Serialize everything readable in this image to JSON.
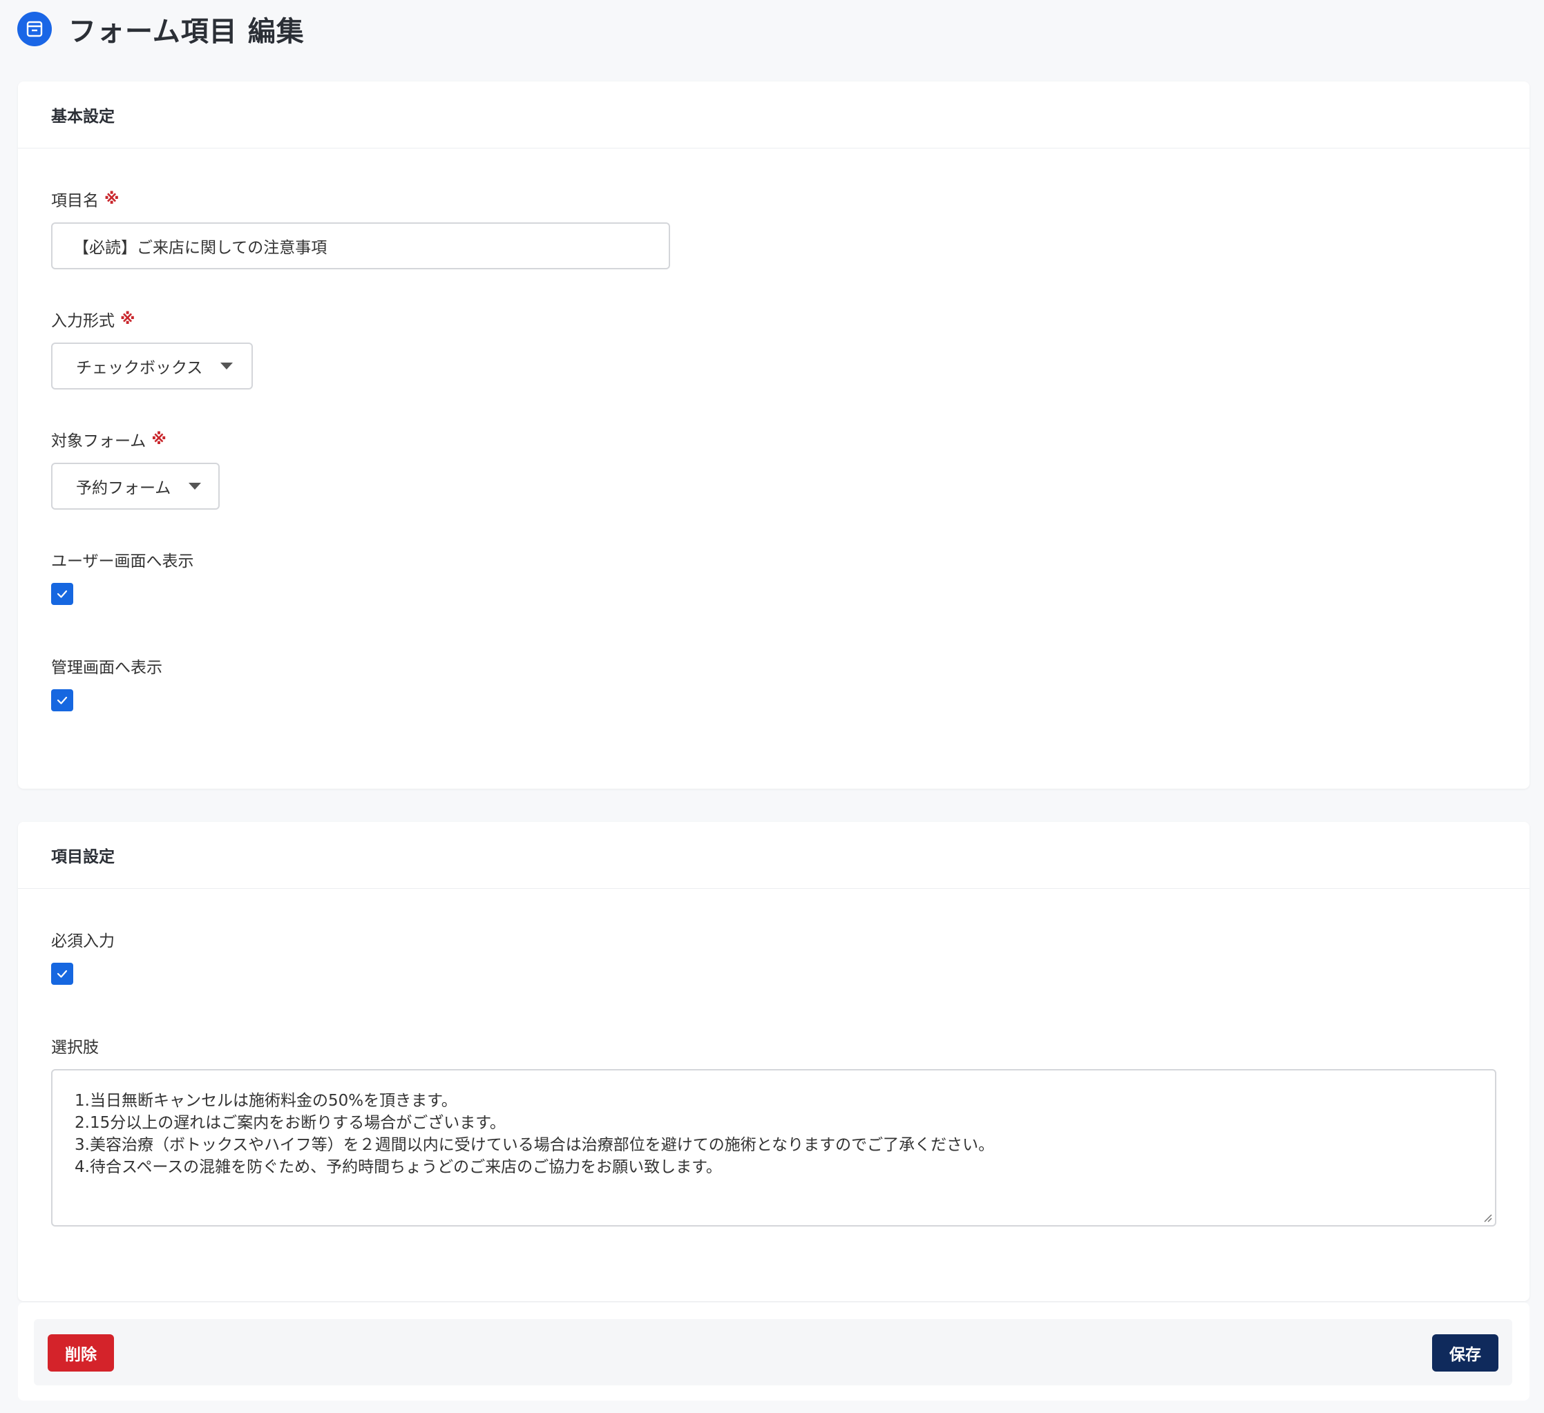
{
  "page": {
    "title": "フォーム項目 編集",
    "icon": "form-icon",
    "accent_color": "#1a66e6"
  },
  "basic_settings": {
    "header": "基本設定",
    "required_mark": "※",
    "item_name": {
      "label": "項目名",
      "value": "【必読】ご来店に関しての注意事項"
    },
    "input_type": {
      "label": "入力形式",
      "selected": "チェックボックス"
    },
    "target_form": {
      "label": "対象フォーム",
      "selected": "予約フォーム"
    },
    "show_user": {
      "label": "ユーザー画面へ表示",
      "checked": true
    },
    "show_admin": {
      "label": "管理画面へ表示",
      "checked": true
    }
  },
  "item_settings": {
    "header": "項目設定",
    "required_input": {
      "label": "必須入力",
      "checked": true
    },
    "choices": {
      "label": "選択肢",
      "lines": [
        "1.当日無断キャンセルは施術料金の50%を頂きます。",
        "2.15分以上の遅れはご案内をお断りする場合がございます。",
        "3.美容治療（ボトックスやハイフ等）を２週間以内に受けている場合は治療部位を避けての施術となりますのでご了承ください。",
        "4.待合スペースの混雑を防ぐため、予約時間ちょうどのご来店のご協力をお願い致します。"
      ]
    }
  },
  "footer": {
    "delete_label": "削除",
    "save_label": "保存",
    "delete_color": "#d4232a",
    "save_color": "#0f2a5c"
  }
}
